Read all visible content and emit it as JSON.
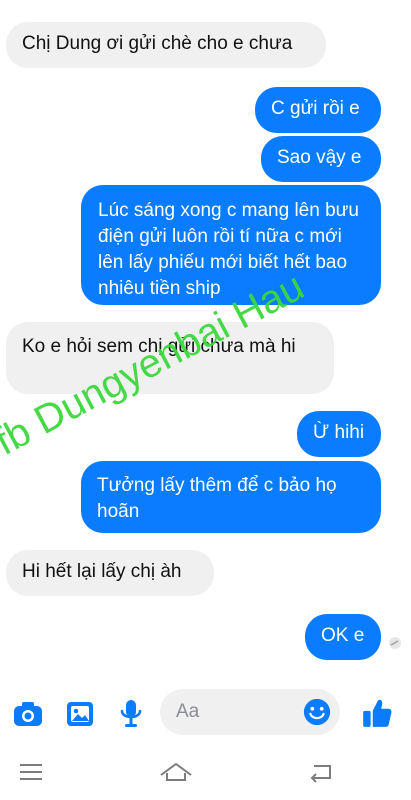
{
  "messages": [
    {
      "side": "in",
      "text": "Chị Dung ơi gửi chè cho e chưa"
    },
    {
      "side": "out",
      "text": "C gửi rồi e"
    },
    {
      "side": "out",
      "text": "Sao vậy e"
    },
    {
      "side": "out",
      "text": "Lúc sáng xong c mang lên bưu điện gửi luôn rồi tí nữa c mới lên lấy phiếu mới biết hết bao nhiêu tiền ship"
    },
    {
      "side": "in",
      "text": "Ko e hỏi sem chị gửi chưa mà hi"
    },
    {
      "side": "out",
      "text": "Ừ hihi"
    },
    {
      "side": "out",
      "text": "Tưởng lấy thêm để c bảo họ hoãn"
    },
    {
      "side": "in",
      "text": "Hi hết lại lấy chị àh"
    },
    {
      "side": "out",
      "text": "OK e"
    }
  ],
  "watermark": "fb Dungyenbai Hau",
  "composer": {
    "placeholder": "Aa",
    "icons": [
      "camera-icon",
      "image-icon",
      "microphone-icon",
      "emoji-icon",
      "thumbs-up-icon"
    ]
  },
  "navbar": {
    "icons": [
      "menu-icon",
      "home-icon",
      "back-icon"
    ]
  },
  "colors": {
    "outgoing_bubble": "#0a7cff",
    "incoming_bubble": "#f1f0f0",
    "accent": "#0a7cff",
    "watermark": "#3cd93c"
  }
}
